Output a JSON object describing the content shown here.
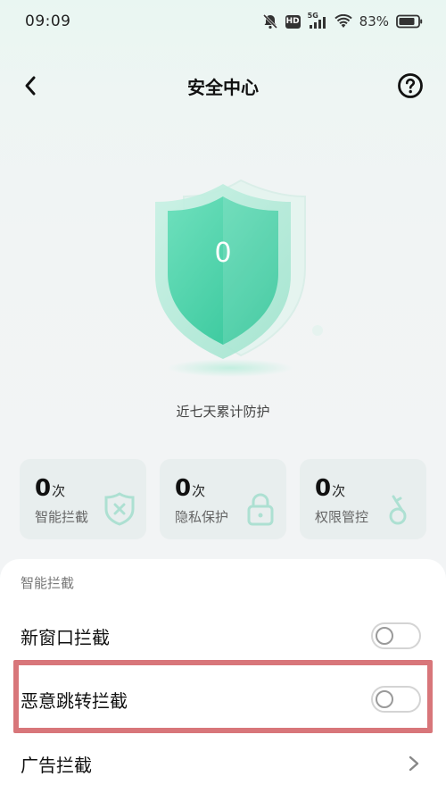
{
  "status_bar": {
    "time": "09:09",
    "hd_label": "HD",
    "network_label": "5G",
    "battery_percent": "83%"
  },
  "nav": {
    "title": "安全中心"
  },
  "shield": {
    "count": "0"
  },
  "caption": "近七天累计防护",
  "stats": [
    {
      "count": "0",
      "unit": "次",
      "label": "智能拦截",
      "icon": "shield-x-icon"
    },
    {
      "count": "0",
      "unit": "次",
      "label": "隐私保护",
      "icon": "lock-icon"
    },
    {
      "count": "0",
      "unit": "次",
      "label": "权限管控",
      "icon": "key-icon"
    }
  ],
  "panel": {
    "section_title": "智能拦截",
    "rows": [
      {
        "label": "新窗口拦截",
        "control": "toggle",
        "enabled": false
      },
      {
        "label": "恶意跳转拦截",
        "control": "toggle",
        "enabled": false
      },
      {
        "label": "广告拦截",
        "control": "chevron"
      }
    ]
  },
  "colors": {
    "accent": "#43d1a8",
    "highlight_box": "#d8767a"
  }
}
